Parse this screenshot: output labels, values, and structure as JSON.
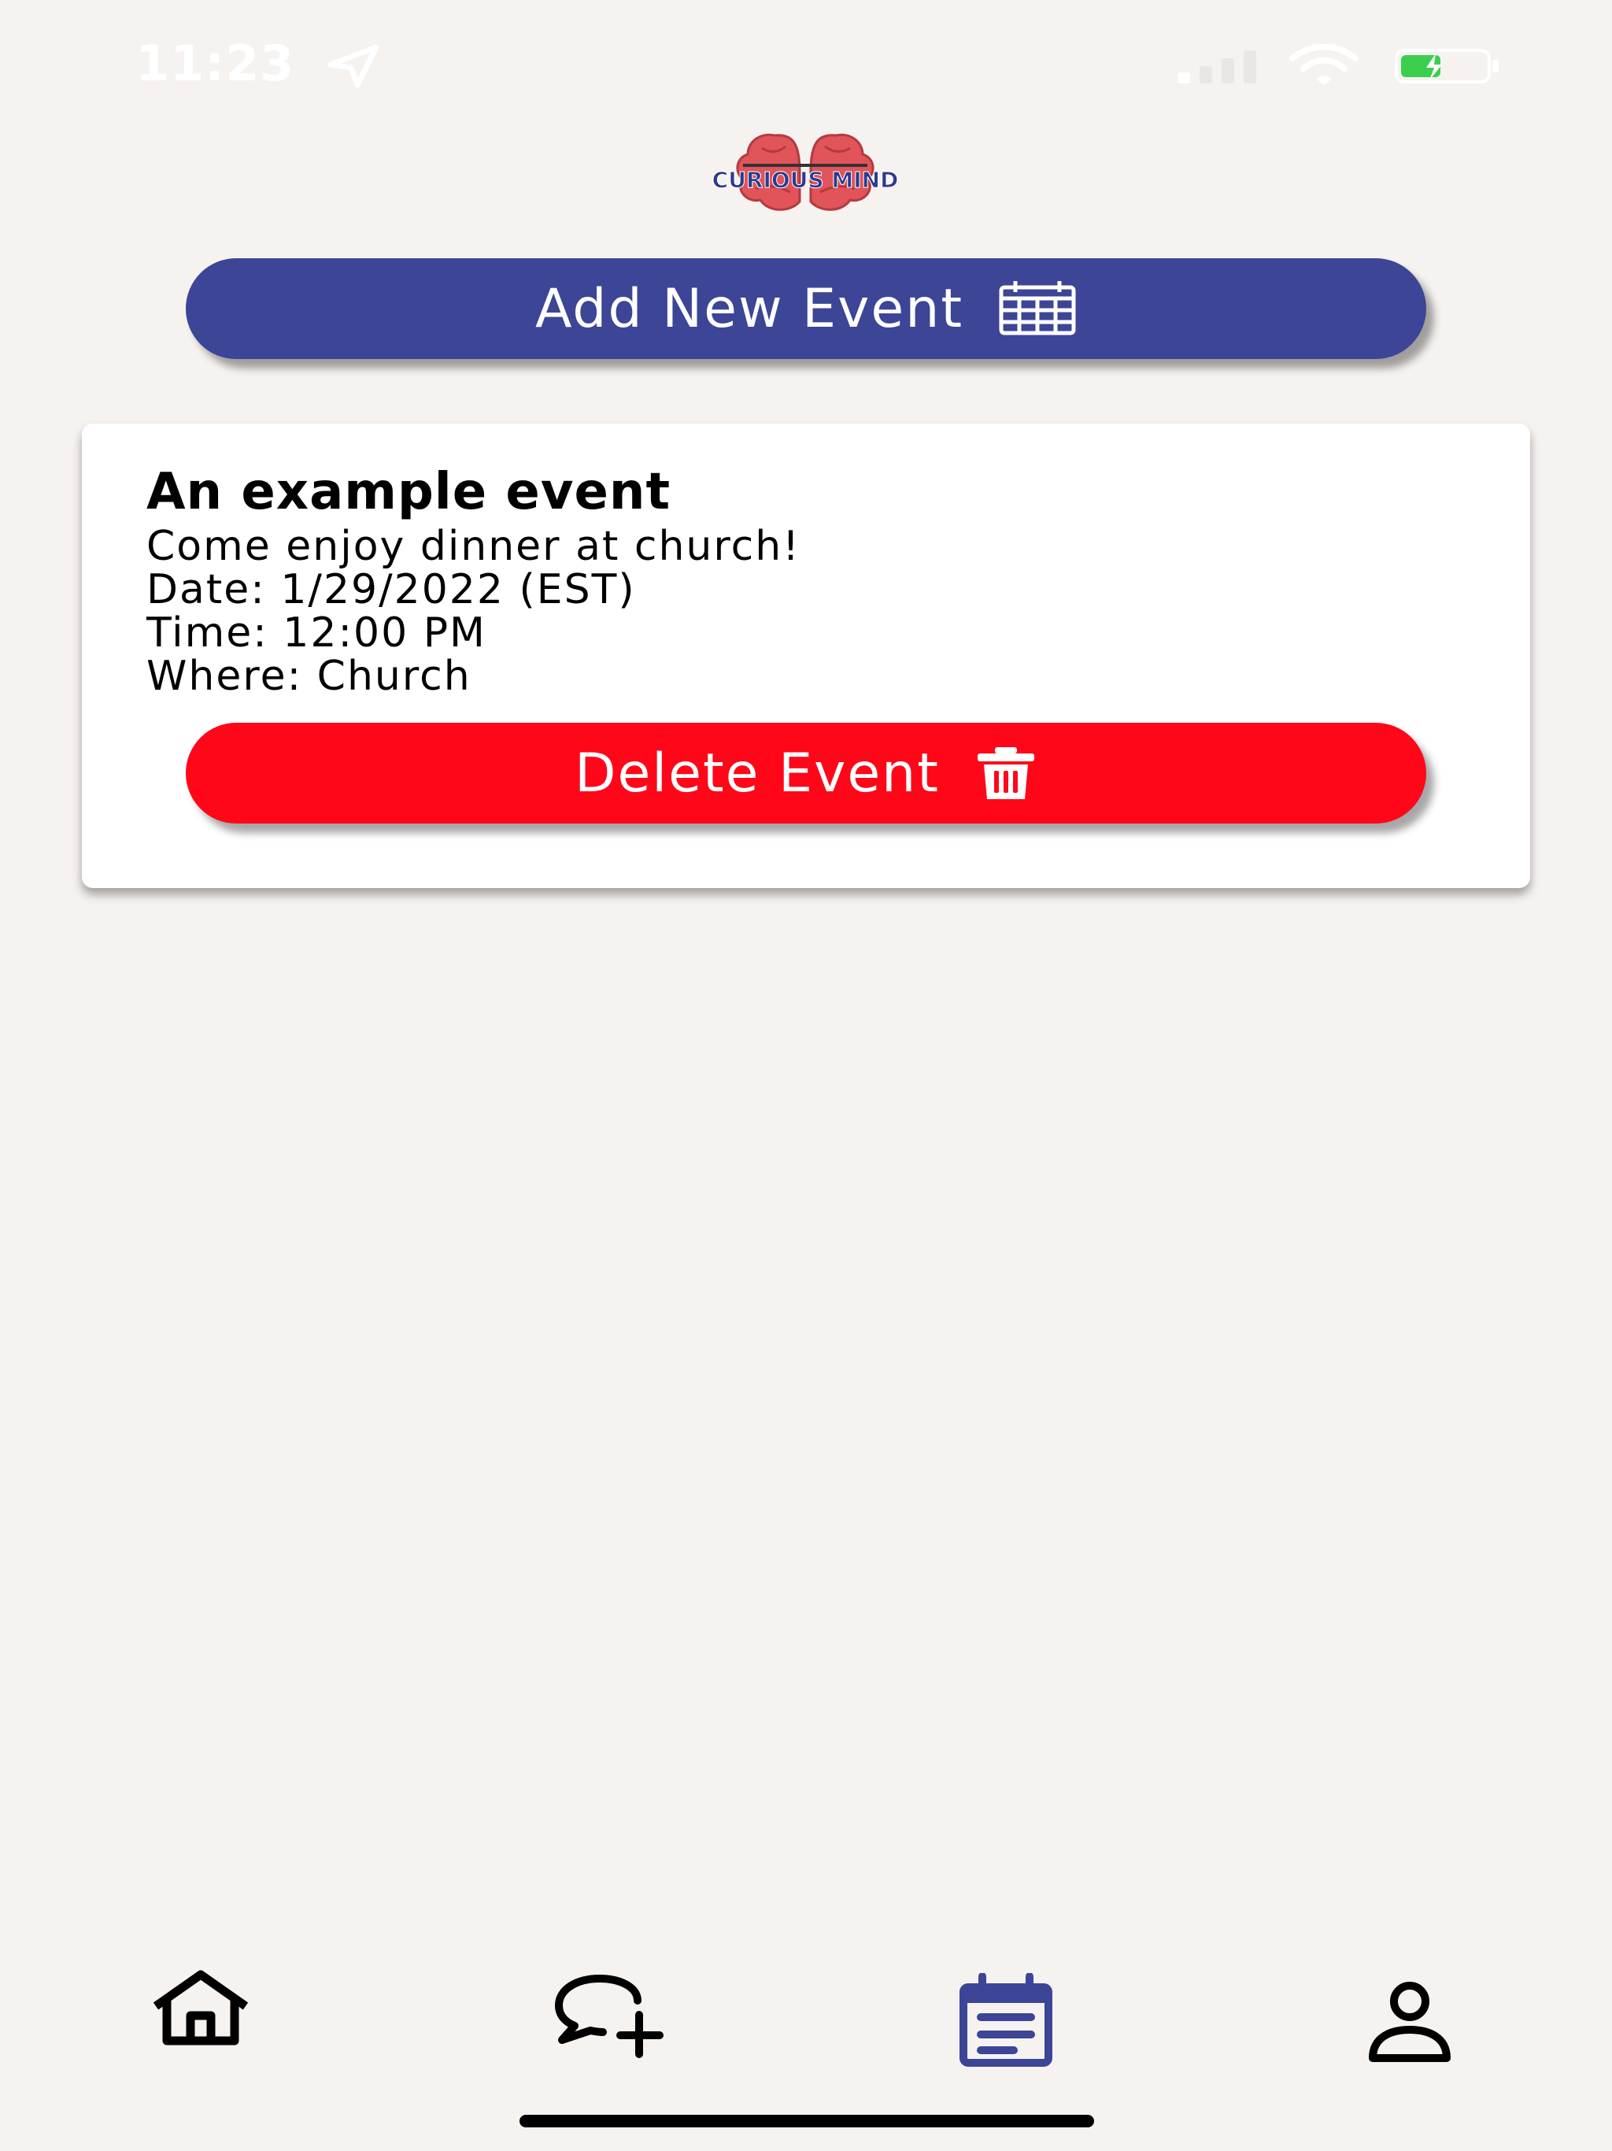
{
  "status_bar": {
    "time": "11:23",
    "icons": [
      "location-arrow-icon",
      "cellular-signal-icon",
      "wifi-icon",
      "battery-charging-icon"
    ]
  },
  "logo": {
    "text": "CURIOUS MIND",
    "colors": {
      "brain": "#e0545a",
      "text": "#2c3a8f"
    }
  },
  "actions": {
    "add_event_label": "Add New Event",
    "add_event_icon": "calendar-icon"
  },
  "events": [
    {
      "title": "An example event",
      "description": "Come enjoy dinner at church!",
      "date": "Date: 1/29/2022 (EST)",
      "time": "Time: 12:00 PM",
      "where": "Where: Church",
      "delete_label": "Delete Event",
      "delete_icon": "trash-icon"
    }
  ],
  "tab_bar": {
    "items": [
      {
        "icon": "home-icon",
        "active": false
      },
      {
        "icon": "chat-add-icon",
        "active": false
      },
      {
        "icon": "calendar-events-icon",
        "active": true
      },
      {
        "icon": "profile-icon",
        "active": false
      }
    ]
  },
  "colors": {
    "background": "#f6f2f0",
    "primary": "#3c4596",
    "danger": "#ff0719",
    "card": "#ffffff",
    "active_tab": "#3c4596"
  }
}
